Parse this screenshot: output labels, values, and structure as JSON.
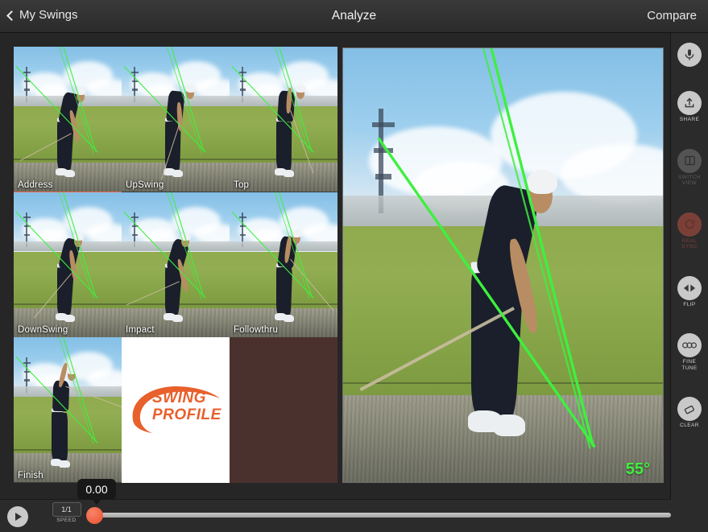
{
  "topbar": {
    "back_label": "My Swings",
    "title": "Analyze",
    "compare_label": "Compare"
  },
  "thumbnails": [
    {
      "label": "Address",
      "type": "frame",
      "selected": true,
      "pose": "address"
    },
    {
      "label": "UpSwing",
      "type": "frame",
      "selected": false,
      "pose": "upswing"
    },
    {
      "label": "Top",
      "type": "frame",
      "selected": false,
      "pose": "top"
    },
    {
      "label": "DownSwing",
      "type": "frame",
      "selected": false,
      "pose": "downswing"
    },
    {
      "label": "Impact",
      "type": "frame",
      "selected": false,
      "pose": "impact"
    },
    {
      "label": "Followthru",
      "type": "frame",
      "selected": false,
      "pose": "followthru"
    },
    {
      "label": "Finish",
      "type": "frame",
      "selected": false,
      "pose": "finish"
    },
    {
      "label": "",
      "type": "logo",
      "selected": false,
      "pose": ""
    },
    {
      "label": "",
      "type": "empty",
      "selected": false,
      "pose": ""
    }
  ],
  "logo": {
    "line1": "SWING",
    "line2": "PROFILE"
  },
  "main_view": {
    "angle_label": "55°",
    "pose": "address"
  },
  "toolbar": [
    {
      "id": "record",
      "label": "",
      "icon": "microphone-icon",
      "state": "active"
    },
    {
      "id": "share",
      "label": "SHARE",
      "icon": "share-icon",
      "state": "active"
    },
    {
      "id": "switch-view",
      "label": "SWITCH\nVIEW",
      "icon": "switch-view-icon",
      "state": "disabled"
    },
    {
      "id": "real-sync",
      "label": "REAL\nSYNC",
      "icon": "real-sync-icon",
      "state": "red-disabled"
    },
    {
      "id": "flip",
      "label": "FLIP",
      "icon": "flip-icon",
      "state": "active"
    },
    {
      "id": "fine-tune",
      "label": "FINE\nTUNE",
      "icon": "fine-tune-icon",
      "state": "active"
    },
    {
      "id": "clear",
      "label": "CLEAR",
      "icon": "eraser-icon",
      "state": "active"
    }
  ],
  "playback": {
    "play_icon": "play-icon",
    "speed_value": "1/1",
    "speed_label": "SPEED",
    "time_value": "0.00",
    "progress_percent": 0
  },
  "colors": {
    "accent_orange": "#f0644a",
    "line_green": "#3ef03e",
    "panel_bg": "#2b2b2b",
    "logo_orange": "#e8602c"
  }
}
